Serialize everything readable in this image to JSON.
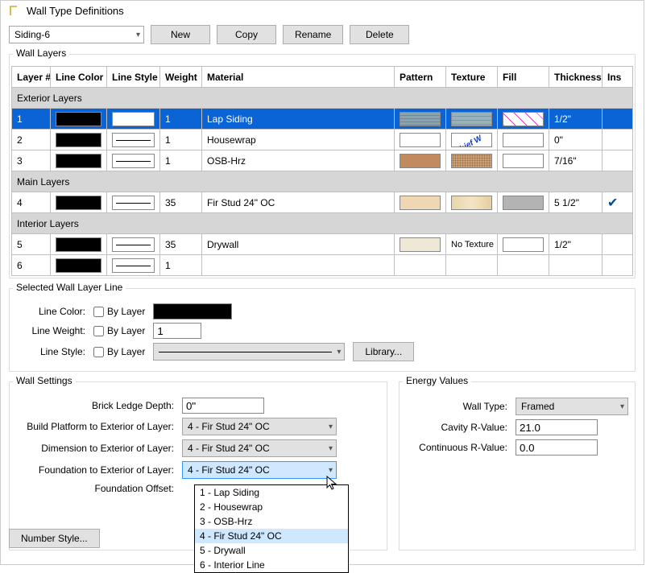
{
  "window": {
    "title": "Wall Type Definitions"
  },
  "topbar": {
    "wall_type": "Siding-6",
    "buttons": {
      "new": "New",
      "copy": "Copy",
      "rename": "Rename",
      "delete": "Delete"
    }
  },
  "wall_layers": {
    "legend": "Wall Layers",
    "headers": {
      "layer_num": "Layer #",
      "line_color": "Line Color",
      "line_style": "Line Style",
      "weight": "Weight",
      "material": "Material",
      "pattern": "Pattern",
      "texture": "Texture",
      "fill": "Fill",
      "thickness": "Thickness",
      "ins": "Ins"
    },
    "groups": {
      "exterior": "Exterior Layers",
      "main": "Main Layers",
      "interior": "Interior Layers"
    },
    "rows": [
      {
        "n": "1",
        "weight": "1",
        "material": "Lap Siding",
        "thickness": "1/2\"",
        "ins": ""
      },
      {
        "n": "2",
        "weight": "1",
        "material": "Housewrap",
        "thickness": "0\"",
        "ins": ""
      },
      {
        "n": "3",
        "weight": "1",
        "material": "OSB-Hrz",
        "thickness": "7/16\"",
        "ins": ""
      },
      {
        "n": "4",
        "weight": "35",
        "material": "Fir Stud 24\" OC",
        "thickness": "5 1/2\"",
        "ins": "✔"
      },
      {
        "n": "5",
        "weight": "35",
        "material": "Drywall",
        "thickness": "1/2\"",
        "ins": ""
      },
      {
        "n": "6",
        "weight": "1",
        "material": "",
        "thickness": "",
        "ins": ""
      }
    ],
    "texture_labels": {
      "none": "No Texture"
    }
  },
  "selected_line": {
    "legend": "Selected Wall Layer Line",
    "line_color_lbl": "Line Color:",
    "line_weight_lbl": "Line Weight:",
    "line_style_lbl": "Line Style:",
    "by_layer": "By Layer",
    "weight_value": "1",
    "library_btn": "Library..."
  },
  "wall_settings": {
    "legend": "Wall Settings",
    "brick_ledge_lbl": "Brick Ledge Depth:",
    "brick_ledge_val": "0\"",
    "build_platform_lbl": "Build Platform to Exterior of Layer:",
    "dimension_lbl": "Dimension to Exterior of Layer:",
    "foundation_lbl": "Foundation to Exterior of Layer:",
    "foundation_offset_lbl": "Foundation Offset:",
    "layer_choice": "4 - Fir Stud 24\" OC",
    "dropdown_options": [
      "1 - Lap Siding",
      "2 - Housewrap",
      "3 - OSB-Hrz",
      "4 - Fir Stud 24\" OC",
      "5 - Drywall",
      "6 - Interior Line"
    ]
  },
  "energy": {
    "legend": "Energy Values",
    "wall_type_lbl": "Wall Type:",
    "wall_type_val": "Framed",
    "cavity_lbl": "Cavity R-Value:",
    "cavity_val": "21.0",
    "continuous_lbl": "Continuous R-Value:",
    "continuous_val": "0.0"
  },
  "footer": {
    "number_style": "Number Style..."
  }
}
